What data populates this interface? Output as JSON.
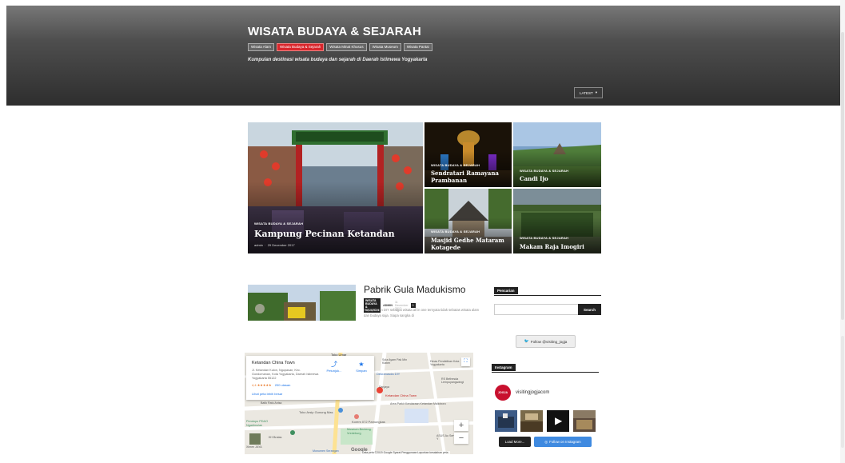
{
  "header": {
    "title": "WISATA BUDAYA & SEJARAH",
    "tags": [
      "Wisata Alam",
      "Wisata Budaya & Sejarah",
      "Wisata Minat Khusus",
      "Wisata Museum",
      "Wisata Pantai"
    ],
    "active_tag": "Wisata Budaya & Sejarah",
    "subtitle": "Kumpulan destinasi wisata budaya dan sejarah di Daerah Istimewa Yogyakarta",
    "sort_label": "LATEST"
  },
  "featured": [
    {
      "category": "WISATA BUDAYA & SEJARAH",
      "title": "Kampung Pecinan Ketandan",
      "author": "admin",
      "date": "29 December 2017"
    },
    {
      "category": "WISATA BUDAYA & SEJARAH",
      "title": "Sendratari Ramayana Prambanan"
    },
    {
      "category": "WISATA BUDAYA & SEJARAH",
      "title": "Candi Ijo"
    },
    {
      "category": "WISATA BUDAYA & SEJARAH",
      "title": "Masjid Gedhe Mataram Kotagede"
    },
    {
      "category": "WISATA BUDAYA & SEJARAH",
      "title": "Makam Raja Imogiri"
    }
  ],
  "post": {
    "title": "Pabrik Gula Madukismo",
    "category": "WISATA BUDAYA & SEJARAH",
    "author": "ADMIN",
    "date": "11 December 2017",
    "comments": "0",
    "excerpt": "Kepopuleran DIY sebagai wisata all in one ternyata tidak sebatas wisata alam dan budaya saja. Siapa sangka di"
  },
  "map": {
    "place_name": "Ketandan China Town",
    "address": "Jl. Ketandan Kulon, Ngupasan, Kec. Gondomanan, Kota Yogyakarta, Daerah Istimewa Yogyakarta 55122",
    "rating": "4,4",
    "stars": "★★★★★",
    "reviews": "200 ulasan",
    "directions_label": "Petunjuk...",
    "save_label": "Simpan",
    "more_link": "Lihat peta lebih besar",
    "zoom_in": "+",
    "zoom_out": "−",
    "google_logo": "Google",
    "footer": "Data peta ©2019 Google   Syarat Penggunaan   Laporkan kesalahan peta",
    "labels": {
      "taku_umar": "Toko Umar",
      "siola": "Sola Ayam Pak Min Klaten",
      "dinas": "Dinas Pendidikan Kota Yogyakarta",
      "dekranasda": "Dekranasda DIY",
      "rs": "RS Bethesda Lempuyangwangi",
      "sanjaya": "Sanjaya",
      "china_town": "Ketandan China Town",
      "parkir": "Area Parkir Kendaraan Ketandan Malioboro",
      "ratu": "Batik Ratu Anisa",
      "toko": "Toko Arsip Gunung Mas",
      "pdao": "Pendopo PDAO Ngadimulan",
      "korem": "Korem 072 Pamungkas",
      "museum": "Museum Benteng Vredeburg",
      "asus": "ASUS Au Service Y",
      "jaya": "Ximen JAYA",
      "bratas": "KH Bratas",
      "kantor": "Monumen Serangan"
    }
  },
  "sidebar": {
    "search_heading": "Pencarian",
    "search_button": "Search",
    "search_placeholder": "",
    "twitter_button": "Follow @visiting_jogja",
    "instagram_heading": "Instagram",
    "instagram_avatar_text": "JOGJA",
    "instagram_username": "visitingjogjacom",
    "load_more": "Load More...",
    "follow_instagram": "Follow on Instagram"
  }
}
